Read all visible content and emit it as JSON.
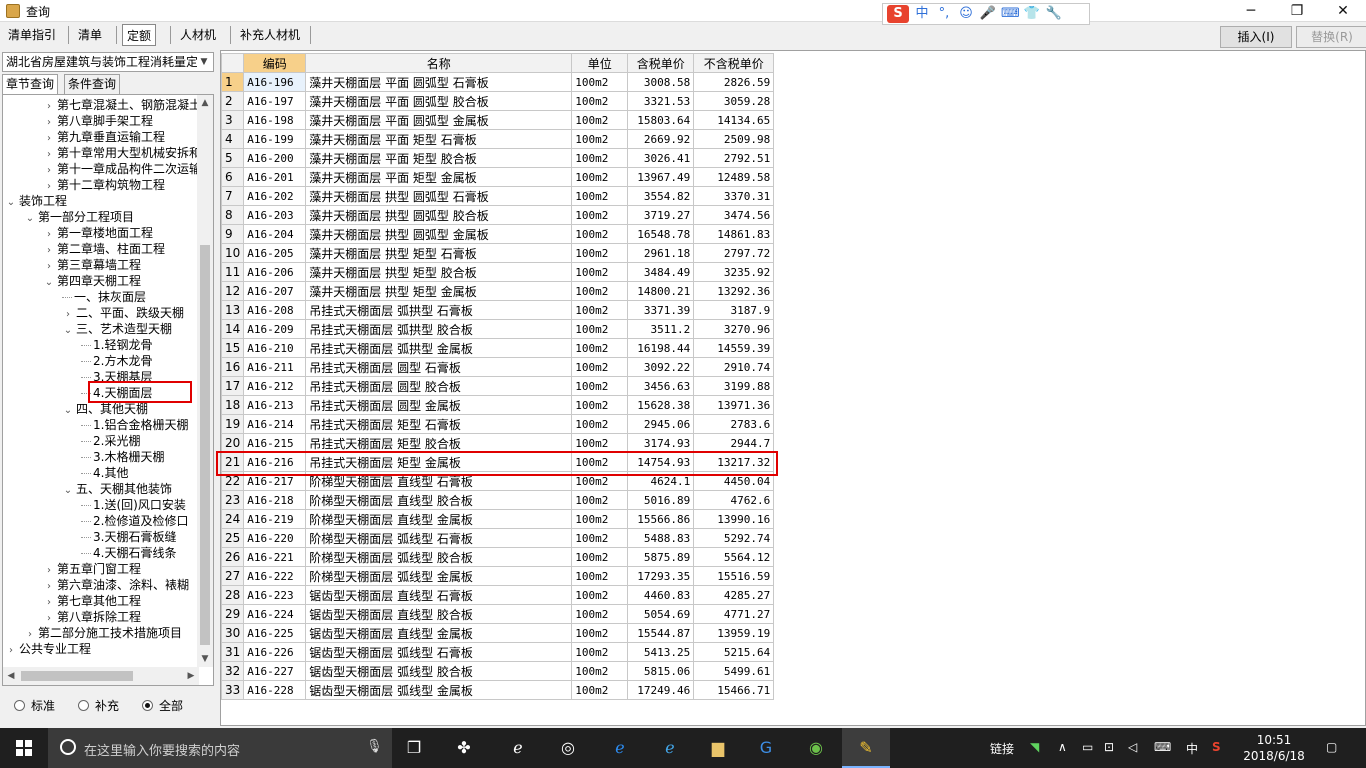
{
  "window": {
    "title": "查询",
    "minimize": "─",
    "maximize": "❐",
    "close": "✕"
  },
  "ime": {
    "logo": "S",
    "items": [
      "中",
      "°,",
      "☺",
      "🎤",
      "⌨",
      "👕",
      "🔧"
    ]
  },
  "toolbar": {
    "tabs": [
      {
        "label": "清单指引"
      },
      {
        "label": "清单"
      },
      {
        "label": "定额"
      },
      {
        "label": "人材机"
      },
      {
        "label": "补充人材机"
      }
    ],
    "insert_label": "插入(I)",
    "replace_label": "替换(R)"
  },
  "left": {
    "library": "湖北省房屋建筑与装饰工程消耗量定额",
    "subtabs": [
      "章节查询",
      "条件查询"
    ],
    "tree": [
      {
        "label": "第七章混凝土、钢筋混凝土",
        "level": 2,
        "toggle": ">"
      },
      {
        "label": "第八章脚手架工程",
        "level": 2,
        "toggle": ">"
      },
      {
        "label": "第九章垂直运输工程",
        "level": 2,
        "toggle": ">"
      },
      {
        "label": "第十章常用大型机械安拆和",
        "level": 2,
        "toggle": ">"
      },
      {
        "label": "第十一章成品构件二次运输",
        "level": 2,
        "toggle": ">"
      },
      {
        "label": "第十二章构筑物工程",
        "level": 2,
        "toggle": ">"
      },
      {
        "label": "装饰工程",
        "level": 0,
        "toggle": "v"
      },
      {
        "label": "第一部分工程项目",
        "level": 1,
        "toggle": "v"
      },
      {
        "label": "第一章楼地面工程",
        "level": 2,
        "toggle": ">"
      },
      {
        "label": "第二章墙、柱面工程",
        "level": 2,
        "toggle": ">"
      },
      {
        "label": "第三章幕墙工程",
        "level": 2,
        "toggle": ">"
      },
      {
        "label": "第四章天棚工程",
        "level": 2,
        "toggle": "v"
      },
      {
        "label": "一、抹灰面层",
        "level": 3,
        "toggle": ""
      },
      {
        "label": "二、平面、跌级天棚",
        "level": 3,
        "toggle": ">"
      },
      {
        "label": "三、艺术造型天棚",
        "level": 3,
        "toggle": "v"
      },
      {
        "label": "1.轻钢龙骨",
        "level": 4,
        "toggle": ""
      },
      {
        "label": "2.方木龙骨",
        "level": 4,
        "toggle": ""
      },
      {
        "label": "3.天棚基层",
        "level": 4,
        "toggle": ""
      },
      {
        "label": "4.天棚面层",
        "level": 4,
        "toggle": ""
      },
      {
        "label": "四、其他天棚",
        "level": 3,
        "toggle": "v"
      },
      {
        "label": "1.铝合金格栅天棚",
        "level": 4,
        "toggle": ""
      },
      {
        "label": "2.采光棚",
        "level": 4,
        "toggle": ""
      },
      {
        "label": "3.木格栅天棚",
        "level": 4,
        "toggle": ""
      },
      {
        "label": "4.其他",
        "level": 4,
        "toggle": ""
      },
      {
        "label": "五、天棚其他装饰",
        "level": 3,
        "toggle": "v"
      },
      {
        "label": "1.送(回)风口安装",
        "level": 4,
        "toggle": ""
      },
      {
        "label": "2.检修道及检修口",
        "level": 4,
        "toggle": ""
      },
      {
        "label": "3.天棚石膏板缝",
        "level": 4,
        "toggle": ""
      },
      {
        "label": "4.天棚石膏线条",
        "level": 4,
        "toggle": ""
      },
      {
        "label": "第五章门窗工程",
        "level": 2,
        "toggle": ">"
      },
      {
        "label": "第六章油漆、涂料、裱糊",
        "level": 2,
        "toggle": ">"
      },
      {
        "label": "第七章其他工程",
        "level": 2,
        "toggle": ">"
      },
      {
        "label": "第八章拆除工程",
        "level": 2,
        "toggle": ">"
      },
      {
        "label": "第二部分施工技术措施项目",
        "level": 1,
        "toggle": ">"
      },
      {
        "label": "公共专业工程",
        "level": 0,
        "toggle": ">"
      }
    ],
    "radios": [
      {
        "label": "标准",
        "checked": false
      },
      {
        "label": "补充",
        "checked": false
      },
      {
        "label": "全部",
        "checked": true
      }
    ]
  },
  "grid": {
    "columns": [
      "",
      "编码",
      "名称",
      "单位",
      "含税单价",
      "不含税单价"
    ],
    "rows": [
      [
        "1",
        "A16-196",
        "藻井天棚面层 平面 圆弧型 石膏板",
        "100m2",
        "3008.58",
        "2826.59"
      ],
      [
        "2",
        "A16-197",
        "藻井天棚面层 平面 圆弧型 胶合板",
        "100m2",
        "3321.53",
        "3059.28"
      ],
      [
        "3",
        "A16-198",
        "藻井天棚面层 平面 圆弧型 金属板",
        "100m2",
        "15803.64",
        "14134.65"
      ],
      [
        "4",
        "A16-199",
        "藻井天棚面层 平面 矩型 石膏板",
        "100m2",
        "2669.92",
        "2509.98"
      ],
      [
        "5",
        "A16-200",
        "藻井天棚面层 平面 矩型 胶合板",
        "100m2",
        "3026.41",
        "2792.51"
      ],
      [
        "6",
        "A16-201",
        "藻井天棚面层 平面 矩型 金属板",
        "100m2",
        "13967.49",
        "12489.58"
      ],
      [
        "7",
        "A16-202",
        "藻井天棚面层 拱型 圆弧型 石膏板",
        "100m2",
        "3554.82",
        "3370.31"
      ],
      [
        "8",
        "A16-203",
        "藻井天棚面层 拱型 圆弧型 胶合板",
        "100m2",
        "3719.27",
        "3474.56"
      ],
      [
        "9",
        "A16-204",
        "藻井天棚面层 拱型 圆弧型 金属板",
        "100m2",
        "16548.78",
        "14861.83"
      ],
      [
        "10",
        "A16-205",
        "藻井天棚面层 拱型 矩型 石膏板",
        "100m2",
        "2961.18",
        "2797.72"
      ],
      [
        "11",
        "A16-206",
        "藻井天棚面层 拱型 矩型 胶合板",
        "100m2",
        "3484.49",
        "3235.92"
      ],
      [
        "12",
        "A16-207",
        "藻井天棚面层 拱型 矩型 金属板",
        "100m2",
        "14800.21",
        "13292.36"
      ],
      [
        "13",
        "A16-208",
        "吊挂式天棚面层 弧拱型 石膏板",
        "100m2",
        "3371.39",
        "3187.9"
      ],
      [
        "14",
        "A16-209",
        "吊挂式天棚面层 弧拱型 胶合板",
        "100m2",
        "3511.2",
        "3270.96"
      ],
      [
        "15",
        "A16-210",
        "吊挂式天棚面层 弧拱型 金属板",
        "100m2",
        "16198.44",
        "14559.39"
      ],
      [
        "16",
        "A16-211",
        "吊挂式天棚面层 圆型 石膏板",
        "100m2",
        "3092.22",
        "2910.74"
      ],
      [
        "17",
        "A16-212",
        "吊挂式天棚面层 圆型 胶合板",
        "100m2",
        "3456.63",
        "3199.88"
      ],
      [
        "18",
        "A16-213",
        "吊挂式天棚面层 圆型 金属板",
        "100m2",
        "15628.38",
        "13971.36"
      ],
      [
        "19",
        "A16-214",
        "吊挂式天棚面层 矩型 石膏板",
        "100m2",
        "2945.06",
        "2783.6"
      ],
      [
        "20",
        "A16-215",
        "吊挂式天棚面层 矩型 胶合板",
        "100m2",
        "3174.93",
        "2944.7"
      ],
      [
        "21",
        "A16-216",
        "吊挂式天棚面层 矩型 金属板",
        "100m2",
        "14754.93",
        "13217.32"
      ],
      [
        "22",
        "A16-217",
        "阶梯型天棚面层 直线型 石膏板",
        "100m2",
        "4624.1",
        "4450.04"
      ],
      [
        "23",
        "A16-218",
        "阶梯型天棚面层 直线型 胶合板",
        "100m2",
        "5016.89",
        "4762.6"
      ],
      [
        "24",
        "A16-219",
        "阶梯型天棚面层 直线型 金属板",
        "100m2",
        "15566.86",
        "13990.16"
      ],
      [
        "25",
        "A16-220",
        "阶梯型天棚面层 弧线型 石膏板",
        "100m2",
        "5488.83",
        "5292.74"
      ],
      [
        "26",
        "A16-221",
        "阶梯型天棚面层 弧线型 胶合板",
        "100m2",
        "5875.89",
        "5564.12"
      ],
      [
        "27",
        "A16-222",
        "阶梯型天棚面层 弧线型 金属板",
        "100m2",
        "17293.35",
        "15516.59"
      ],
      [
        "28",
        "A16-223",
        "锯齿型天棚面层 直线型 石膏板",
        "100m2",
        "4460.83",
        "4285.27"
      ],
      [
        "29",
        "A16-224",
        "锯齿型天棚面层 直线型 胶合板",
        "100m2",
        "5054.69",
        "4771.27"
      ],
      [
        "30",
        "A16-225",
        "锯齿型天棚面层 直线型 金属板",
        "100m2",
        "15544.87",
        "13959.19"
      ],
      [
        "31",
        "A16-226",
        "锯齿型天棚面层 弧线型 石膏板",
        "100m2",
        "5413.25",
        "5215.64"
      ],
      [
        "32",
        "A16-227",
        "锯齿型天棚面层 弧线型 胶合板",
        "100m2",
        "5815.06",
        "5499.61"
      ],
      [
        "33",
        "A16-228",
        "锯齿型天棚面层 弧线型 金属板",
        "100m2",
        "17249.46",
        "15466.71"
      ]
    ]
  },
  "taskbar": {
    "search_placeholder": "在这里输入你要搜索的内容",
    "tray_link": "链接",
    "tray_ime": "中",
    "time": "10:51",
    "date": "2018/6/18"
  }
}
